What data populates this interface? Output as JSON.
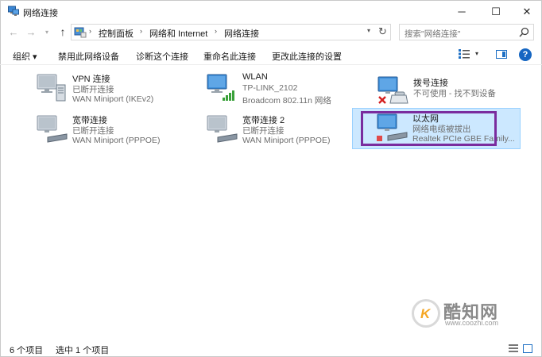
{
  "window": {
    "title": "网络连接",
    "minimize": "─",
    "maximize": "☐",
    "close": "✕"
  },
  "nav": {
    "back": "←",
    "forward": "→",
    "recent": "▾",
    "up": "↑",
    "breadcrumb": [
      "控制面板",
      "网络和 Internet",
      "网络连接"
    ],
    "address_dropdown": "▾",
    "refresh": "↻",
    "search_placeholder": "搜索\"网络连接\""
  },
  "commands": {
    "organize": "组织 ▾",
    "disable": "禁用此网络设备",
    "diagnose": "诊断这个连接",
    "rename": "重命名此连接",
    "change": "更改此连接的设置",
    "view_dropdown": "▾",
    "help": "?"
  },
  "connections": [
    {
      "name": "VPN 连接",
      "status": "已断开连接",
      "device": "WAN Miniport (IKEv2)",
      "icon": "vpn-connection-icon"
    },
    {
      "name": "WLAN",
      "status": "TP-LINK_2102",
      "device": "Broadcom 802.11n 网络",
      "icon": "wlan-connection-icon"
    },
    {
      "name": "拨号连接",
      "status": "不可使用 - 找不到设备",
      "device": "",
      "icon": "dialup-connection-icon"
    },
    {
      "name": "宽带连接",
      "status": "已断开连接",
      "device": "WAN Miniport (PPPOE)",
      "icon": "broadband-connection-icon"
    },
    {
      "name": "宽带连接 2",
      "status": "已断开连接",
      "device": "WAN Miniport (PPPOE)",
      "icon": "broadband-connection-icon"
    },
    {
      "name": "以太网",
      "status": "网络电缆被拔出",
      "device": "Realtek PCIe GBE Family...",
      "icon": "ethernet-connection-icon"
    }
  ],
  "status": {
    "count": "6 个项目",
    "selected": "选中 1 个项目"
  },
  "watermark": {
    "logo_letter": "K",
    "name": "酷知网",
    "url": "www.coozhi.com"
  },
  "colors": {
    "selection_bg": "#cce8ff",
    "selection_border": "#99d1ff",
    "highlight_box": "#7a2c9e",
    "accent": "#1666c2"
  }
}
